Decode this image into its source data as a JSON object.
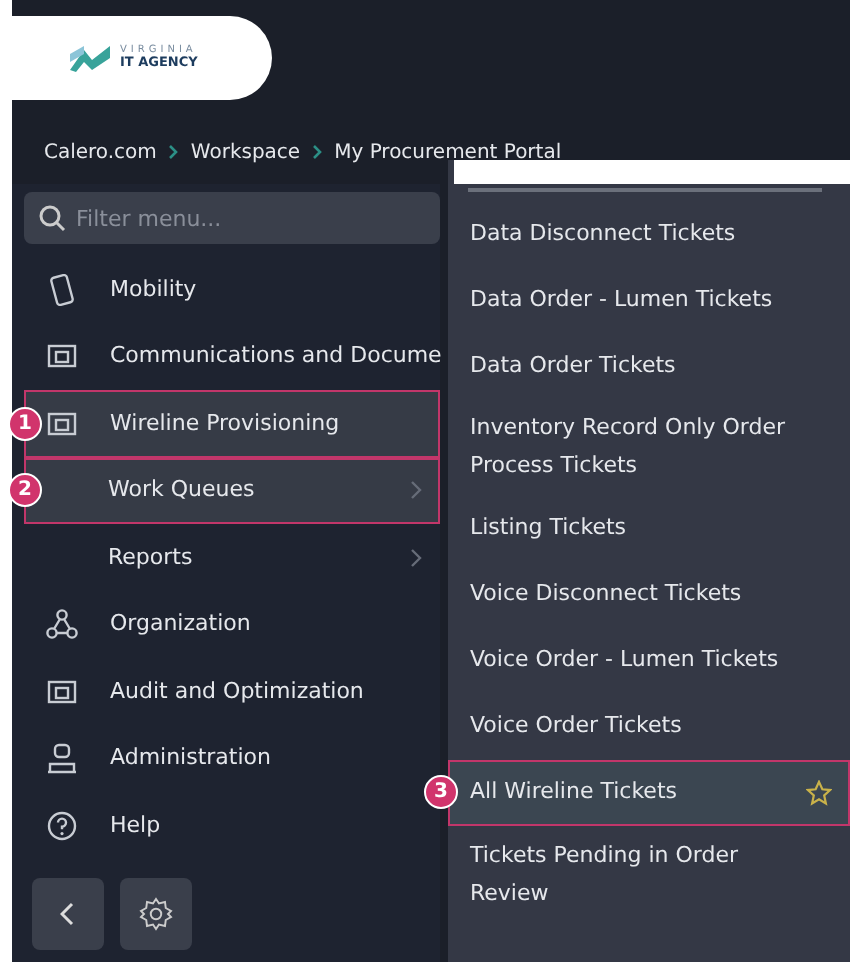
{
  "logo": {
    "line_1": "VIRGINIA",
    "line_2": "IT AGENCY"
  },
  "breadcrumbs": [
    {
      "label": "Calero.com"
    },
    {
      "label": "Workspace"
    },
    {
      "label": "My Procurement Portal"
    }
  ],
  "sidebar": {
    "filter": {
      "placeholder": "Filter menu..."
    },
    "items": [
      {
        "label": "Mobility",
        "kind": "item",
        "has_submenu": false,
        "selected": false
      },
      {
        "label": "Communications and Docume",
        "kind": "item",
        "has_submenu": false,
        "selected": false
      },
      {
        "label": "Wireline Provisioning",
        "kind": "item",
        "has_submenu": false,
        "selected": true,
        "callout": "1"
      },
      {
        "label": "Work Queues",
        "kind": "subitem",
        "has_submenu": true,
        "selected": true,
        "callout": "2"
      },
      {
        "label": "Reports",
        "kind": "subitem",
        "has_submenu": true,
        "selected": false
      },
      {
        "label": "Organization",
        "kind": "item",
        "has_submenu": false,
        "selected": false
      },
      {
        "label": "Audit and Optimization",
        "kind": "item",
        "has_submenu": false,
        "selected": false
      },
      {
        "label": "Administration",
        "kind": "item",
        "has_submenu": false,
        "selected": false
      },
      {
        "label": "Help",
        "kind": "item",
        "has_submenu": false,
        "selected": false
      }
    ]
  },
  "flyout": {
    "items": [
      {
        "label": "Data Disconnect Tickets",
        "selected": false
      },
      {
        "label": "Data Order - Lumen Tickets",
        "selected": false
      },
      {
        "label": "Data Order Tickets",
        "selected": false
      },
      {
        "label": "Inventory Record Only Order Process Tickets",
        "selected": false
      },
      {
        "label": "Listing Tickets",
        "selected": false
      },
      {
        "label": "Voice Disconnect Tickets",
        "selected": false
      },
      {
        "label": "Voice Order - Lumen Tickets",
        "selected": false
      },
      {
        "label": "Voice Order Tickets",
        "selected": false
      },
      {
        "label": "All Wireline Tickets",
        "selected": true,
        "callout": "3",
        "favorite": true
      },
      {
        "label": "Tickets Pending in Order Review",
        "selected": false
      }
    ]
  }
}
